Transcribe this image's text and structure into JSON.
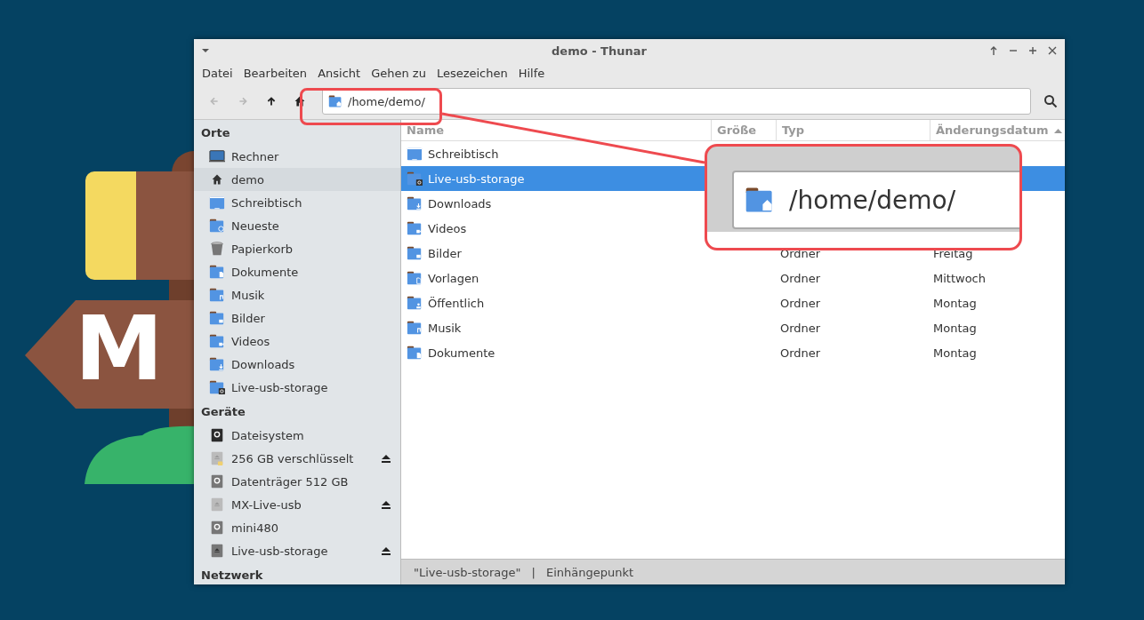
{
  "desktop": {
    "logo_letter": "M"
  },
  "window": {
    "title": "demo - Thunar"
  },
  "menu": [
    "Datei",
    "Bearbeiten",
    "Ansicht",
    "Gehen zu",
    "Lesezeichen",
    "Hilfe"
  ],
  "toolbar": {
    "nav_buttons": [
      {
        "kind": "back",
        "disabled": true
      },
      {
        "kind": "forward",
        "disabled": true
      },
      {
        "kind": "up",
        "disabled": false
      },
      {
        "kind": "home",
        "disabled": false
      }
    ],
    "location": "/home/demo/"
  },
  "sidebar": {
    "sections": [
      {
        "title": "Orte",
        "items": [
          {
            "label": "Rechner",
            "kind": "computer",
            "selected": false,
            "ejectable": false
          },
          {
            "label": "demo",
            "kind": "home",
            "selected": true,
            "ejectable": false
          },
          {
            "label": "Schreibtisch",
            "kind": "desktop",
            "selected": false,
            "ejectable": false
          },
          {
            "label": "Neueste",
            "kind": "folder-recent",
            "selected": false,
            "ejectable": false
          },
          {
            "label": "Papierkorb",
            "kind": "trash",
            "selected": false,
            "ejectable": false
          },
          {
            "label": "Dokumente",
            "kind": "folder-doc",
            "selected": false,
            "ejectable": false
          },
          {
            "label": "Musik",
            "kind": "folder-music",
            "selected": false,
            "ejectable": false
          },
          {
            "label": "Bilder",
            "kind": "folder-pictures",
            "selected": false,
            "ejectable": false
          },
          {
            "label": "Videos",
            "kind": "folder-video",
            "selected": false,
            "ejectable": false
          },
          {
            "label": "Downloads",
            "kind": "folder-download",
            "selected": false,
            "ejectable": false
          },
          {
            "label": "Live-usb-storage",
            "kind": "folder-drive",
            "selected": false,
            "ejectable": false
          }
        ]
      },
      {
        "title": "Geräte",
        "items": [
          {
            "label": "Dateisystem",
            "kind": "disk-dark",
            "selected": false,
            "ejectable": false
          },
          {
            "label": "256 GB verschlüsselt",
            "kind": "removable-locked",
            "selected": false,
            "ejectable": true
          },
          {
            "label": "Datenträger 512 GB",
            "kind": "disk-grey",
            "selected": false,
            "ejectable": false
          },
          {
            "label": "MX-Live-usb",
            "kind": "removable-light",
            "selected": false,
            "ejectable": true
          },
          {
            "label": "mini480",
            "kind": "disk-grey",
            "selected": false,
            "ejectable": false
          },
          {
            "label": "Live-usb-storage",
            "kind": "removable-dark",
            "selected": false,
            "ejectable": true
          }
        ]
      },
      {
        "title": "Netzwerk"
      }
    ]
  },
  "table": {
    "columns": [
      {
        "label": "Name",
        "sorted": false
      },
      {
        "label": "Größe",
        "sorted": false
      },
      {
        "label": "Typ",
        "sorted": false
      },
      {
        "label": "Änderungsdatum",
        "sorted": true
      }
    ],
    "rows": [
      {
        "name": "Schreibtisch",
        "kind": "desktop",
        "selected": false
      },
      {
        "name": "Live-usb-storage",
        "kind": "folder-drive",
        "selected": true
      },
      {
        "name": "Downloads",
        "kind": "folder-download",
        "selected": false
      },
      {
        "name": "Videos",
        "kind": "folder-video",
        "selected": false
      },
      {
        "name": "Bilder",
        "kind": "folder-pictures",
        "type": "Ordner",
        "date": "Freitag",
        "selected": false
      },
      {
        "name": "Vorlagen",
        "kind": "folder-template",
        "type": "Ordner",
        "date": "Mittwoch",
        "selected": false
      },
      {
        "name": "Öffentlich",
        "kind": "folder-public",
        "type": "Ordner",
        "date": "Montag",
        "selected": false
      },
      {
        "name": "Musik",
        "kind": "folder-music",
        "type": "Ordner",
        "date": "Montag",
        "selected": false
      },
      {
        "name": "Dokumente",
        "kind": "folder-doc",
        "type": "Ordner",
        "date": "Montag",
        "selected": false
      }
    ]
  },
  "status_bar": [
    "\"Live-usb-storage\"",
    "|",
    "Einhängepunkt"
  ],
  "callout": {
    "location": "/home/demo/"
  }
}
